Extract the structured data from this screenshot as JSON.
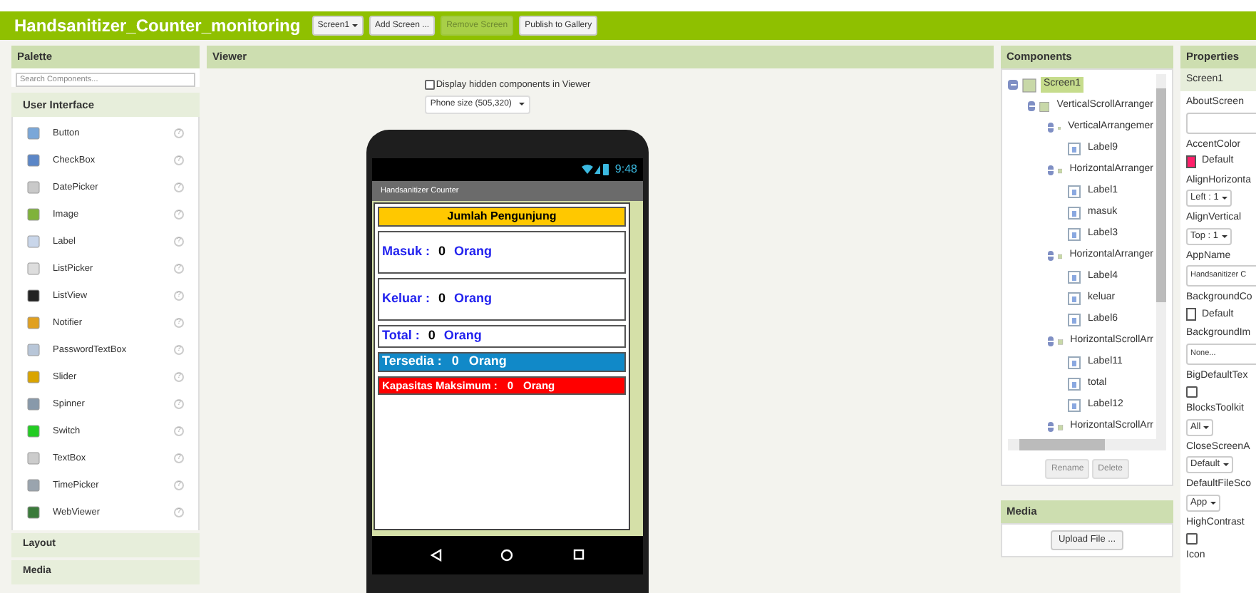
{
  "project": {
    "title": "Handsanitizer_Counter_monitoring",
    "screen_select": "Screen1",
    "buttons": [
      {
        "label": "Add Screen ...",
        "disabled": false
      },
      {
        "label": "Remove Screen",
        "disabled": true
      },
      {
        "label": "Publish to Gallery",
        "disabled": false
      }
    ]
  },
  "palette": {
    "title": "Palette",
    "search": {
      "placeholder": "Search Components..."
    },
    "category": "User Interface",
    "help": "?",
    "items": [
      {
        "label": "Button"
      },
      {
        "label": "CheckBox"
      },
      {
        "label": "DatePicker"
      },
      {
        "label": "Image"
      },
      {
        "label": "Label"
      },
      {
        "label": "ListPicker"
      },
      {
        "label": "ListView"
      },
      {
        "label": "Notifier"
      },
      {
        "label": "PasswordTextBox"
      },
      {
        "label": "Slider"
      },
      {
        "label": "Spinner"
      },
      {
        "label": "Switch"
      },
      {
        "label": "TextBox"
      },
      {
        "label": "TimePicker"
      },
      {
        "label": "WebViewer"
      }
    ],
    "more_categories": [
      "Layout",
      "Media"
    ]
  },
  "viewer": {
    "title": "Viewer",
    "hidden_checkbox": {
      "label": "Display hidden components in Viewer",
      "checked": false
    },
    "phone_size": "Phone size (505,320)",
    "phone": {
      "time": "9:48",
      "app_title": "Handsanitizer Counter",
      "rows": [
        {
          "kind": "header",
          "text": "Jumlah Pengunjung",
          "color": "#ffc800"
        },
        {
          "kind": "tall",
          "label": "Masuk :",
          "value": "0",
          "unit": "Orang"
        },
        {
          "kind": "tall",
          "label": "Keluar :",
          "value": "0",
          "unit": "Orang"
        },
        {
          "kind": "short",
          "label": "Total :",
          "value": "0",
          "unit": "Orang"
        },
        {
          "kind": "filled",
          "label": "Tersedia :",
          "value": "0",
          "unit": "Orang",
          "color": "#1189c8"
        },
        {
          "kind": "filled",
          "label": "Kapasitas Maksimum :",
          "value": "0",
          "unit": "Orang",
          "color": "#ff0000"
        }
      ]
    }
  },
  "components": {
    "title": "Components",
    "tree": [
      {
        "label": "Screen1",
        "selected": true,
        "expanded": true,
        "children": [
          {
            "label": "VerticalScrollArranger",
            "selected": false,
            "expanded": true,
            "children": [
              {
                "label": "VerticalArrangemer",
                "selected": false,
                "expanded": true,
                "children": [
                  {
                    "label": "Label9",
                    "selected": false
                  }
                ]
              },
              {
                "label": "HorizontalArranger",
                "selected": false,
                "expanded": true,
                "children": [
                  {
                    "label": "Label1",
                    "selected": false
                  },
                  {
                    "label": "masuk",
                    "selected": false
                  },
                  {
                    "label": "Label3",
                    "selected": false
                  }
                ]
              },
              {
                "label": "HorizontalArranger",
                "selected": false,
                "expanded": true,
                "children": [
                  {
                    "label": "Label4",
                    "selected": false
                  },
                  {
                    "label": "keluar",
                    "selected": false
                  },
                  {
                    "label": "Label6",
                    "selected": false
                  }
                ]
              },
              {
                "label": "HorizontalScrollArr",
                "selected": false,
                "expanded": true,
                "children": [
                  {
                    "label": "Label11",
                    "selected": false
                  },
                  {
                    "label": "total",
                    "selected": false
                  },
                  {
                    "label": "Label12",
                    "selected": false
                  }
                ]
              },
              {
                "label": "HorizontalScrollArr",
                "selected": false,
                "expanded": true
              }
            ]
          }
        ]
      }
    ],
    "buttons": [
      "Rename",
      "Delete"
    ]
  },
  "media": {
    "title": "Media",
    "button": "Upload File ..."
  },
  "properties": {
    "title": "Properties",
    "component": "Screen1",
    "items": [
      {
        "kind": "text",
        "label": "AboutScreen",
        "value": ""
      },
      {
        "kind": "color",
        "label": "AccentColor",
        "value": "Default",
        "color": "#ff1f6a"
      },
      {
        "kind": "select",
        "label": "AlignHorizonta",
        "value": "Left : 1"
      },
      {
        "kind": "select",
        "label": "AlignVertical",
        "value": "Top : 1"
      },
      {
        "kind": "text",
        "label": "AppName",
        "value": "Handsanitizer C"
      },
      {
        "kind": "color",
        "label": "BackgroundCo",
        "value": "Default",
        "color": "#ffffff"
      },
      {
        "kind": "text",
        "label": "BackgroundIm",
        "value": "None..."
      },
      {
        "kind": "check",
        "label": "BigDefaultTex",
        "checked": false
      },
      {
        "kind": "select",
        "label": "BlocksToolkit",
        "value": "All"
      },
      {
        "kind": "select",
        "label": "CloseScreenA",
        "value": "Default"
      },
      {
        "kind": "select",
        "label": "DefaultFileSco",
        "value": "App"
      },
      {
        "kind": "check",
        "label": "HighContrast",
        "checked": false
      },
      {
        "kind": "label",
        "label": "Icon"
      }
    ]
  }
}
